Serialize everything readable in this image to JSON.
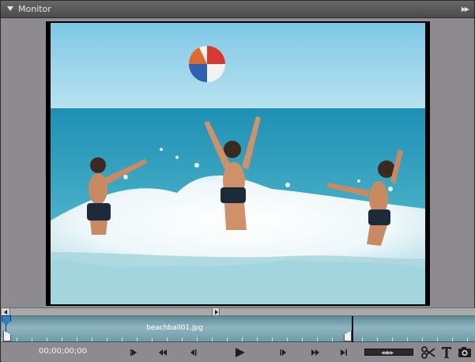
{
  "panel": {
    "title": "Monitor",
    "collapse_icon": "chevron-down-icon",
    "menu_icon": "panel-menu-icon"
  },
  "monitor": {
    "preview": "video-preview"
  },
  "timeline": {
    "clip_name": "beachball01.jpg"
  },
  "controls": {
    "timecode": "00;00;00;00",
    "buttons": [
      {
        "name": "go-to-previous-edit-button",
        "icon": "mark-in-icon"
      },
      {
        "name": "rewind-button",
        "icon": "rewind-icon"
      },
      {
        "name": "step-back-button",
        "icon": "step-back-icon"
      },
      {
        "name": "play-button",
        "icon": "play-icon"
      },
      {
        "name": "step-forward-button",
        "icon": "step-forward-icon"
      },
      {
        "name": "fast-forward-button",
        "icon": "fast-forward-icon"
      },
      {
        "name": "go-to-next-edit-button",
        "icon": "mark-out-icon"
      }
    ],
    "tools": [
      {
        "name": "split-clip-button",
        "icon": "scissors-icon"
      },
      {
        "name": "add-title-button",
        "icon": "text-icon"
      },
      {
        "name": "freeze-frame-button",
        "icon": "camera-icon"
      }
    ]
  },
  "colors": {
    "panel_bg": "#8e8b90",
    "titlebar": "#555555",
    "timeline": "#7fa8b5",
    "playhead": "#2d7ec9"
  }
}
